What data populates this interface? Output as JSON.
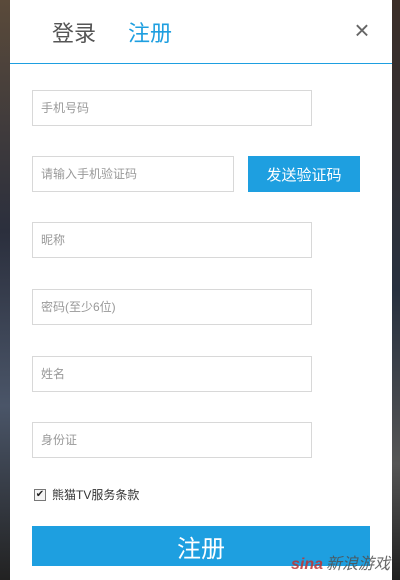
{
  "tabs": {
    "login": "登录",
    "register": "注册"
  },
  "close_symbol": "×",
  "form": {
    "phone_placeholder": "手机号码",
    "code_placeholder": "请输入手机验证码",
    "send_code_label": "发送验证码",
    "nickname_placeholder": "昵称",
    "password_placeholder": "密码(至少6位)",
    "name_placeholder": "姓名",
    "id_placeholder": "身份证",
    "agree_checked": true,
    "agree_label": "熊猫TV服务条款",
    "submit_label": "注册"
  },
  "watermark": {
    "brand": "sina",
    "text": "新浪游戏"
  },
  "colors": {
    "accent": "#1e9fe0",
    "tab_inactive": "#555555",
    "border": "#d8d8d8"
  },
  "icons": {
    "close": "close-icon",
    "checkbox": "checkmark-icon"
  }
}
